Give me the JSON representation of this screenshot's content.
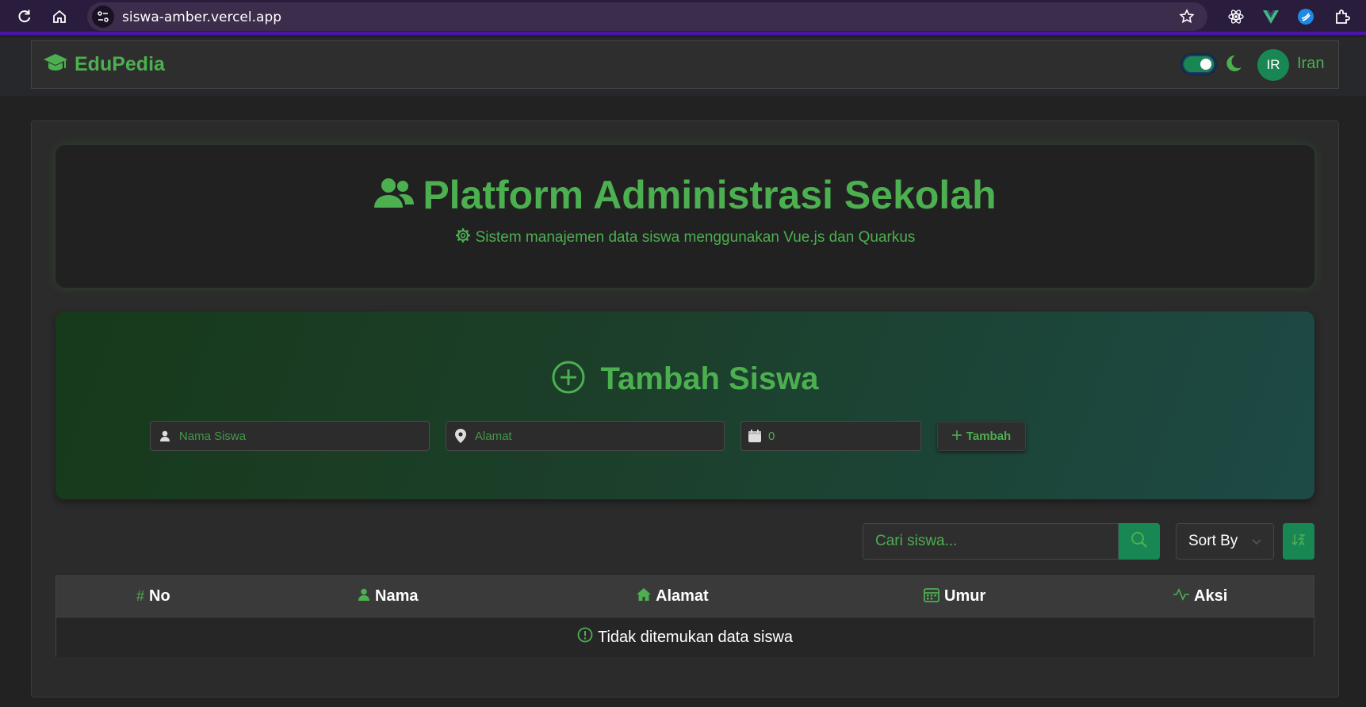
{
  "browser": {
    "url": "siswa-amber.vercel.app"
  },
  "navbar": {
    "brand": "EduPedia",
    "theme_toggle_on": true,
    "avatar_initials": "IR",
    "username": "Iran"
  },
  "hero": {
    "title": "Platform Administrasi Sekolah",
    "subtitle": "Sistem manajemen data siswa menggunakan Vue.js dan Quarkus"
  },
  "add_form": {
    "title": "Tambah Siswa",
    "name_placeholder": "Nama Siswa",
    "address_placeholder": "Alamat",
    "age_value": "0",
    "submit_label": "Tambah"
  },
  "toolbar": {
    "search_placeholder": "Cari siswa...",
    "sort_label": "Sort By"
  },
  "table": {
    "columns": [
      "No",
      "Nama",
      "Alamat",
      "Umur",
      "Aksi"
    ],
    "empty_message": "Tidak ditemukan data siswa",
    "rows": []
  },
  "colors": {
    "accent": "#4caf50",
    "primary_button": "#198754",
    "browser_bar": "#2a1c3c",
    "background": "#222222"
  }
}
